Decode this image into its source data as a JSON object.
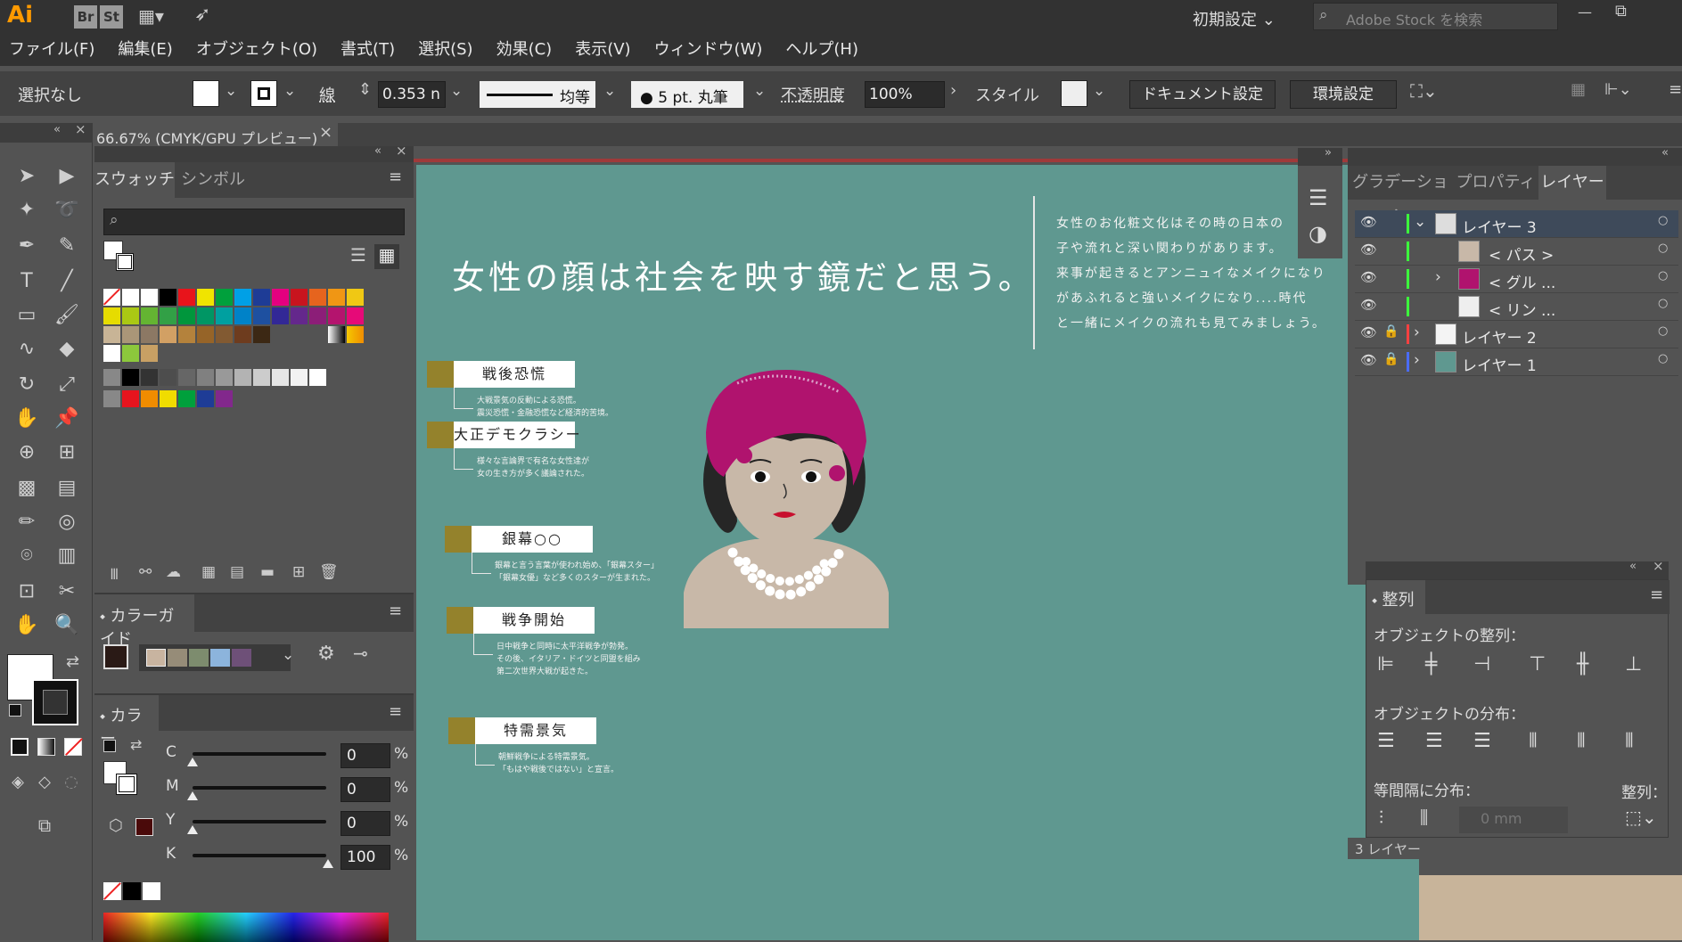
{
  "app": {
    "logo": "Ai",
    "br": "Br",
    "st": "St",
    "workspace": "初期設定",
    "search_placeholder": "Adobe Stock を検索"
  },
  "menu": [
    "ファイル(F)",
    "編集(E)",
    "オブジェクト(O)",
    "書式(T)",
    "選択(S)",
    "効果(C)",
    "表示(V)",
    "ウィンドウ(W)",
    "ヘルプ(H)"
  ],
  "control": {
    "selection": "選択なし",
    "stroke_label": "線",
    "stroke_value": "0.353 n",
    "profile": "均等",
    "brush": "5 pt. 丸筆",
    "opacity_label": "不透明度",
    "opacity_value": "100%",
    "style_label": "スタイル",
    "doc_setup": "ドキュメント設定",
    "prefs": "環境設定"
  },
  "doc_tab": {
    "title": "66.67% (CMYK/GPU プレビュー)",
    "close": "×"
  },
  "swatches": {
    "tab1": "スウォッチ",
    "tab2": "シンボル",
    "colors": [
      "#e8141b",
      "#f0e400",
      "#00a03c",
      "#00a0e6",
      "#1e3c96",
      "#e4007f",
      "#c8141e",
      "#e6641e",
      "#f09614",
      "#f0c814",
      "#e6dc00",
      "#aac814",
      "#64b432",
      "#32a046",
      "#00963c",
      "#009664",
      "#00a0a0",
      "#0082c8",
      "#1e50a0",
      "#322896",
      "#64288c",
      "#8c1e78",
      "#b4146e",
      "#e60a78",
      "#c8b496",
      "#aa9678",
      "#8c7864",
      "#d2a064",
      "#b4823c",
      "#966428",
      "#825a32",
      "#6e3c1e",
      "#3c2814"
    ],
    "grays": [
      "#000000",
      "#333333",
      "#4d4d4d",
      "#666666",
      "#808080",
      "#999999",
      "#b3b3b3",
      "#cccccc",
      "#e6e6e6",
      "#f2f2f2",
      "#ffffff"
    ],
    "brights": [
      "#e6141e",
      "#f08c00",
      "#f0dc00",
      "#00a03c",
      "#1e3c96",
      "#82288c"
    ]
  },
  "color_guide": {
    "title": "カラーガイド",
    "swatches": [
      "#c8b4a0",
      "#968c78",
      "#7d8c6e",
      "#8cb4dc",
      "#6e5078"
    ]
  },
  "color": {
    "title": "カラー",
    "channels": [
      {
        "name": "C",
        "value": "0",
        "unit": "%"
      },
      {
        "name": "M",
        "value": "0",
        "unit": "%"
      },
      {
        "name": "Y",
        "value": "0",
        "unit": "%"
      },
      {
        "name": "K",
        "value": "100",
        "unit": "%"
      }
    ]
  },
  "right_tabs": {
    "tab1": "グラデーション",
    "tab2": "プロパティ",
    "tab3": "レイヤー"
  },
  "layers": [
    {
      "name": "レイヤー 3",
      "color": "#3c6eff"
    },
    {
      "name": "< パス >"
    },
    {
      "name": "< グル ..."
    },
    {
      "name": "< リン ..."
    },
    {
      "name": "レイヤー 2",
      "color": "#ff3c3c"
    },
    {
      "name": "レイヤー 1",
      "color": "#3c6eff"
    }
  ],
  "layers_footer": "3 レイヤー",
  "align": {
    "title": "整列",
    "obj_align": "オブジェクトの整列：",
    "obj_dist": "オブジェクトの分布：",
    "spacing": "等間隔に分布：",
    "align_to": "整列：",
    "spacing_value": "0 mm"
  },
  "artboard": {
    "headline": "女性の顔は社会を映す鏡だと思う。",
    "intro": [
      "女性のお化粧文化はその時の日本の",
      "子や流れと深い関わりがあります。",
      "来事が起きるとアンニュイなメイクになり",
      "があふれると強いメイクになり....時代",
      "と一緒にメイクの流れも見てみましょう。"
    ],
    "items": [
      {
        "title": "戦後恐慌",
        "desc": [
          "大戦景気の反動による恐慌。",
          "震災恐慌・金融恐慌など経済的苦境。"
        ]
      },
      {
        "title": "大正デモクラシー",
        "desc": [
          "様々な言論界で有名な女性達が",
          "女の生き方が多く議論された。"
        ]
      },
      {
        "title": "銀幕○○",
        "desc": [
          "銀幕と言う言葉が使われ始め、「銀幕スター」",
          "「銀幕女優」など多くのスターが生まれた。"
        ]
      },
      {
        "title": "戦争開始",
        "desc": [
          "日中戦争と同時に太平洋戦争が勃発。",
          "その後、イタリア・ドイツと同盟を組み",
          "第二次世界大戦が起きた。"
        ]
      },
      {
        "title": "特需景気",
        "desc": [
          "朝鮮戦争による特需景気。",
          "「もはや戦後ではない」と宣言。"
        ]
      }
    ]
  }
}
